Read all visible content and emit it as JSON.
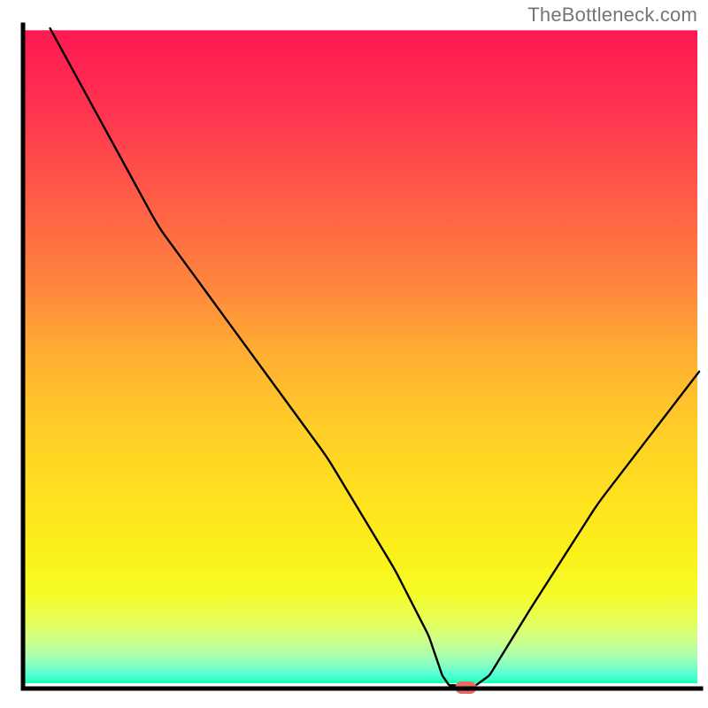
{
  "watermark": "TheBottleneck.com",
  "chart_data": {
    "type": "line",
    "title": "",
    "xlabel": "",
    "ylabel": "",
    "xlim": [
      0,
      100
    ],
    "ylim": [
      0,
      100
    ],
    "curve_points": [
      {
        "x": 4,
        "y": 100
      },
      {
        "x": 20,
        "y": 70
      },
      {
        "x": 30,
        "y": 56
      },
      {
        "x": 45,
        "y": 35
      },
      {
        "x": 55,
        "y": 18
      },
      {
        "x": 60,
        "y": 8
      },
      {
        "x": 62,
        "y": 2
      },
      {
        "x": 63,
        "y": 0.5
      },
      {
        "x": 65,
        "y": 0.5
      },
      {
        "x": 67,
        "y": 0.5
      },
      {
        "x": 69,
        "y": 2
      },
      {
        "x": 75,
        "y": 12
      },
      {
        "x": 85,
        "y": 28
      },
      {
        "x": 100,
        "y": 48
      }
    ],
    "marker": {
      "x": 65.5,
      "y": 0,
      "color": "#ea6a63"
    },
    "gradient_stops": [
      {
        "offset": 0.0,
        "color": "#ff1853"
      },
      {
        "offset": 0.12,
        "color": "#ff3350"
      },
      {
        "offset": 0.25,
        "color": "#ff5a47"
      },
      {
        "offset": 0.38,
        "color": "#ff823e"
      },
      {
        "offset": 0.5,
        "color": "#ffb032"
      },
      {
        "offset": 0.62,
        "color": "#ffd026"
      },
      {
        "offset": 0.72,
        "color": "#ffe21f"
      },
      {
        "offset": 0.8,
        "color": "#fcf01a"
      },
      {
        "offset": 0.86,
        "color": "#f6fb25"
      },
      {
        "offset": 0.905,
        "color": "#e6ff5a"
      },
      {
        "offset": 0.935,
        "color": "#ccff8a"
      },
      {
        "offset": 0.958,
        "color": "#a8ffb0"
      },
      {
        "offset": 0.975,
        "color": "#7dffc8"
      },
      {
        "offset": 0.988,
        "color": "#4effd5"
      },
      {
        "offset": 1.0,
        "color": "#1dffb8"
      }
    ],
    "gradient_bounds": {
      "top_fraction": 0.043,
      "bottom_fraction": 0.965
    }
  }
}
